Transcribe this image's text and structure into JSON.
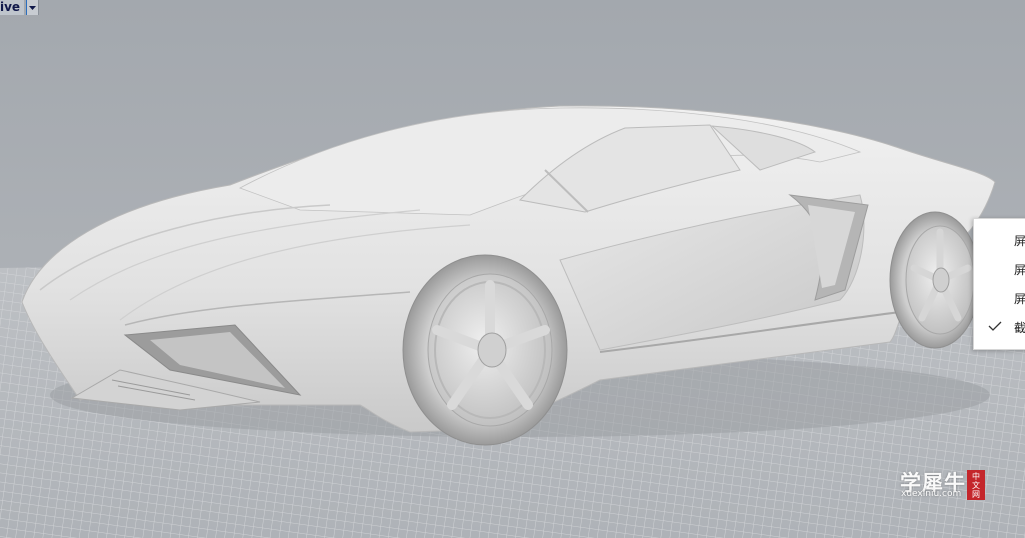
{
  "viewport": {
    "title": "ive",
    "dropdown_icon": "triangle-down-icon",
    "background_color": "#a9adb2",
    "grid_color": "#d5d7da",
    "model_color": "#e6e6e6"
  },
  "context_menu": {
    "items": [
      {
        "label": "屏",
        "checked": false
      },
      {
        "label": "屏",
        "checked": false
      },
      {
        "label": "屏",
        "checked": false
      },
      {
        "label": "截",
        "checked": true
      }
    ],
    "check_icon": "checkmark-icon"
  },
  "watermark": {
    "main_text": "学犀牛",
    "sub_text": "xuexiniu.com",
    "seal_chars": [
      "中",
      "文",
      "网"
    ],
    "seal_color": "#c4262b"
  }
}
